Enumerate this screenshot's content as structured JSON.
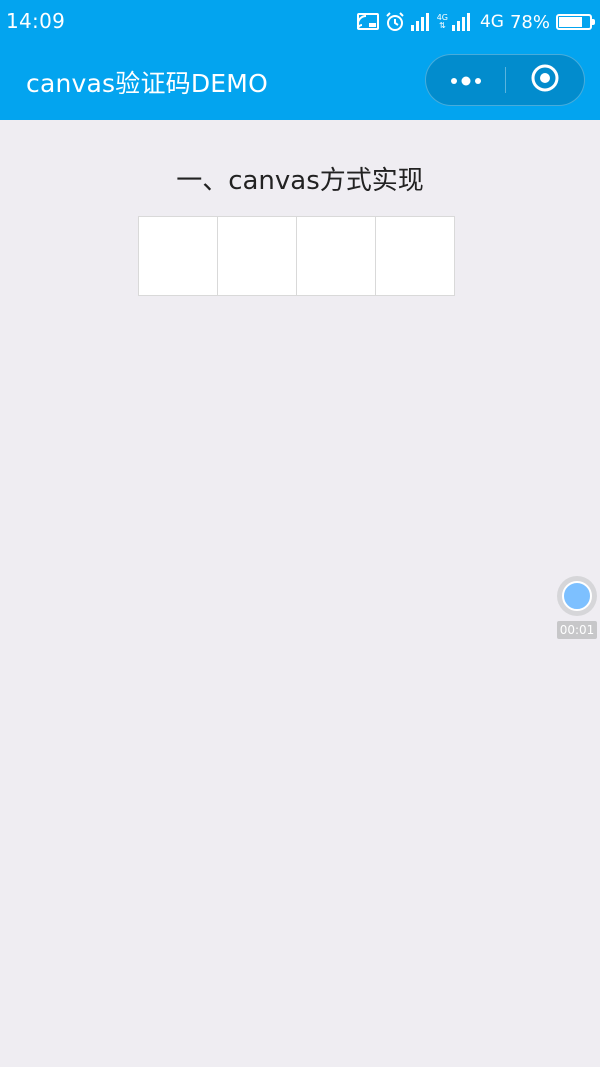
{
  "status_bar": {
    "time": "14:09",
    "network_small": "4G",
    "network": "4G",
    "battery_percent": "78%",
    "battery_level": 0.78,
    "icons": [
      "cast-icon",
      "alarm-icon",
      "signal-icon",
      "signal-icon",
      "battery-icon"
    ]
  },
  "nav": {
    "title": "canvas验证码DEMO",
    "background_color": "#03a4ef",
    "capsule": {
      "more_icon": "more-dots-icon",
      "close_icon": "target-circle-icon"
    }
  },
  "main": {
    "section_title": "一、canvas方式实现",
    "code_boxes": [
      "",
      "",
      "",
      ""
    ]
  },
  "floating_recorder": {
    "timer": "00:01",
    "accent_color": "#7dc0ff"
  }
}
